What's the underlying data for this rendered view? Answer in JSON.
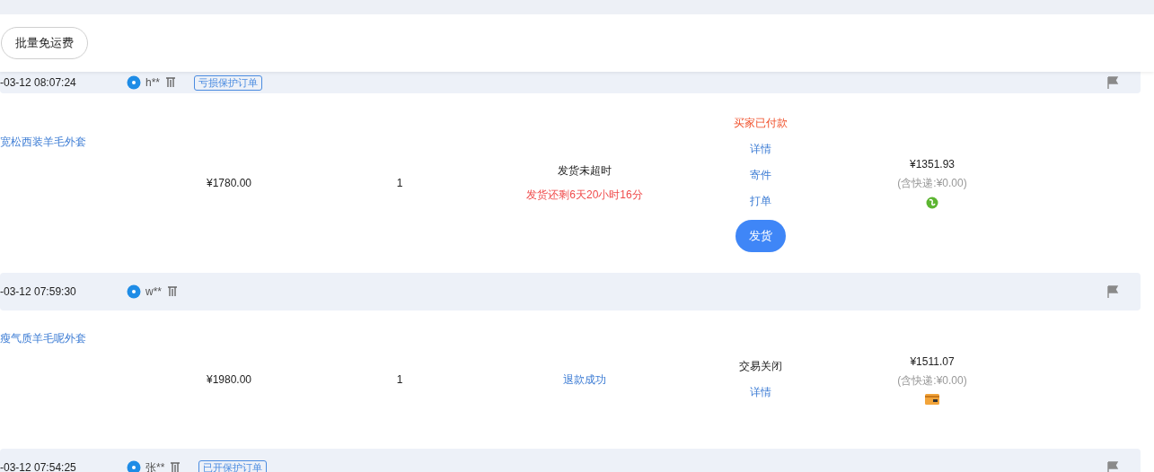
{
  "toolbar": {
    "batch_button": "批量免运费"
  },
  "orders": [
    {
      "kind": "awaiting",
      "time": "-03-12 08:07:24",
      "buyer": "h**",
      "tag": "亏损保护订单",
      "product": "宽松西装羊毛外套",
      "price": "¥1780.00",
      "qty": "1",
      "status": {
        "kind": "countdown",
        "title": "发货未超时",
        "note": "发货还剩6天20小时16分"
      },
      "actions": [
        {
          "kind": "alert",
          "text": "买家已付款"
        },
        {
          "kind": "link",
          "text": "详情"
        },
        {
          "kind": "link",
          "text": "寄件"
        },
        {
          "kind": "link",
          "text": "打单"
        },
        {
          "kind": "button",
          "text": "发货"
        }
      ],
      "total": "¥1351.93",
      "shipping": "(含快递:¥0.00)"
    },
    {
      "kind": "closed",
      "time": "-03-12 07:59:30",
      "buyer": "w**",
      "product": "瘦气质羊毛呢外套",
      "price": "¥1980.00",
      "qty": "1",
      "status": {
        "kind": "refund",
        "title": "退款成功"
      },
      "actions": [
        {
          "kind": "plain",
          "text": "交易关闭"
        },
        {
          "kind": "link",
          "text": "详情"
        }
      ],
      "total": "¥1511.07",
      "shipping": "(含快递:¥0.00)"
    },
    {
      "kind": "header_only",
      "time": "-03-12 07:54:25",
      "buyer": "张**",
      "tag": "已开保护订单"
    }
  ]
}
